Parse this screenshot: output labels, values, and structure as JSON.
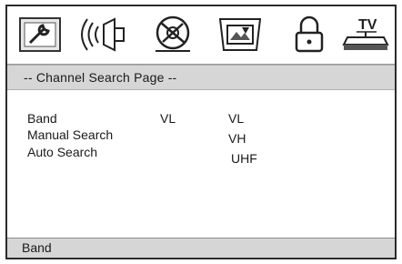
{
  "tabs": [
    {
      "icon": "wrench-icon"
    },
    {
      "icon": "speaker-icon"
    },
    {
      "icon": "disc-icon"
    },
    {
      "icon": "video-icon"
    },
    {
      "icon": "lock-icon"
    },
    {
      "icon": "tv-icon",
      "label": "TV"
    }
  ],
  "page": {
    "title": "-- Channel Search Page --"
  },
  "settings": {
    "band_label": "Band",
    "band_value": "VL",
    "manual_search_label": "Manual Search",
    "auto_search_label": "Auto Search"
  },
  "options": [
    "VL",
    "VH",
    "UHF"
  ],
  "status": {
    "text": "Band"
  },
  "colors": {
    "bar_bg": "#d6d6d6",
    "border": "#2b2b2b"
  }
}
